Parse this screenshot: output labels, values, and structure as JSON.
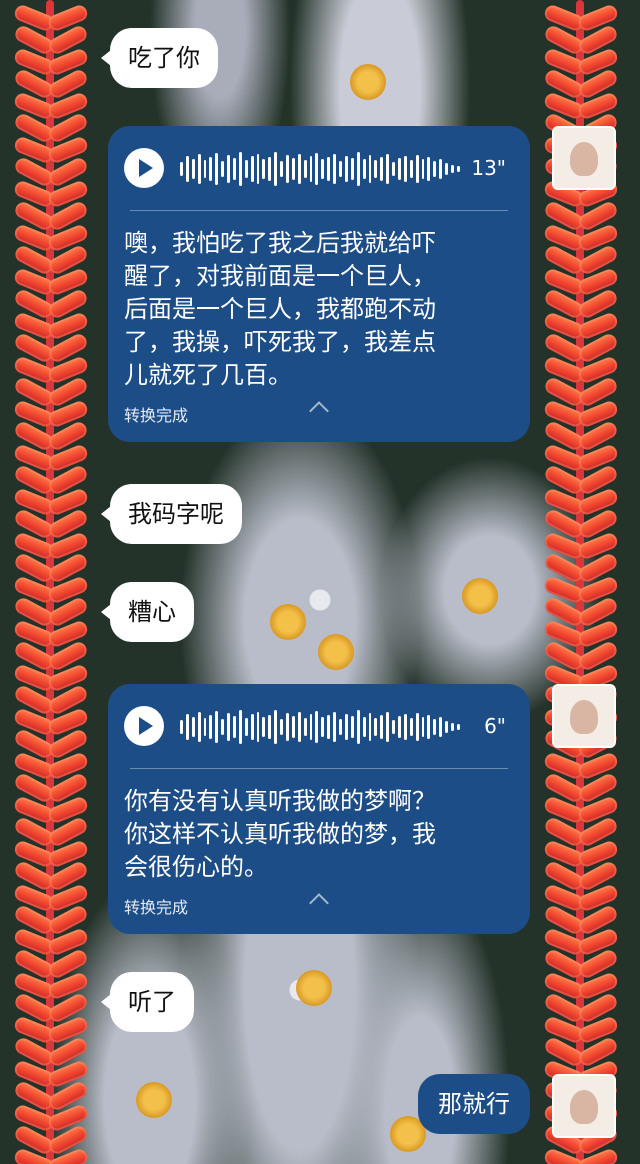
{
  "messages": [
    {
      "type": "text",
      "side": "incoming",
      "text": "吃了你"
    },
    {
      "type": "voice",
      "side": "incoming",
      "duration": "13\"",
      "transcript": "噢，我怕吃了我之后我就给吓\n醒了，对我前面是一个巨人，\n后面是一个巨人，我都跑不动\n了，我操，吓死我了，我差点\n儿就死了几百。",
      "status": "转换完成"
    },
    {
      "type": "text",
      "side": "incoming",
      "text": "我码字呢"
    },
    {
      "type": "text",
      "side": "incoming",
      "text": "糟心"
    },
    {
      "type": "voice",
      "side": "incoming",
      "duration": "6\"",
      "transcript": "你有没有认真听我做的梦啊？\n你这样不认真听我做的梦，我\n会很伤心的。",
      "status": "转换完成"
    },
    {
      "type": "text",
      "side": "incoming",
      "text": "听了"
    },
    {
      "type": "text",
      "side": "outgoing",
      "text": "那就行"
    }
  ],
  "colors": {
    "incoming_bubble": "#ffffff",
    "voice_card": "#1d4d86",
    "outgoing_bubble": "#1d4d86",
    "garland": "#f0452e"
  },
  "icons": [
    "play-icon",
    "waveform-icon",
    "collapse-chevron-icon",
    "avatar-icon",
    "firecracker-garland"
  ]
}
